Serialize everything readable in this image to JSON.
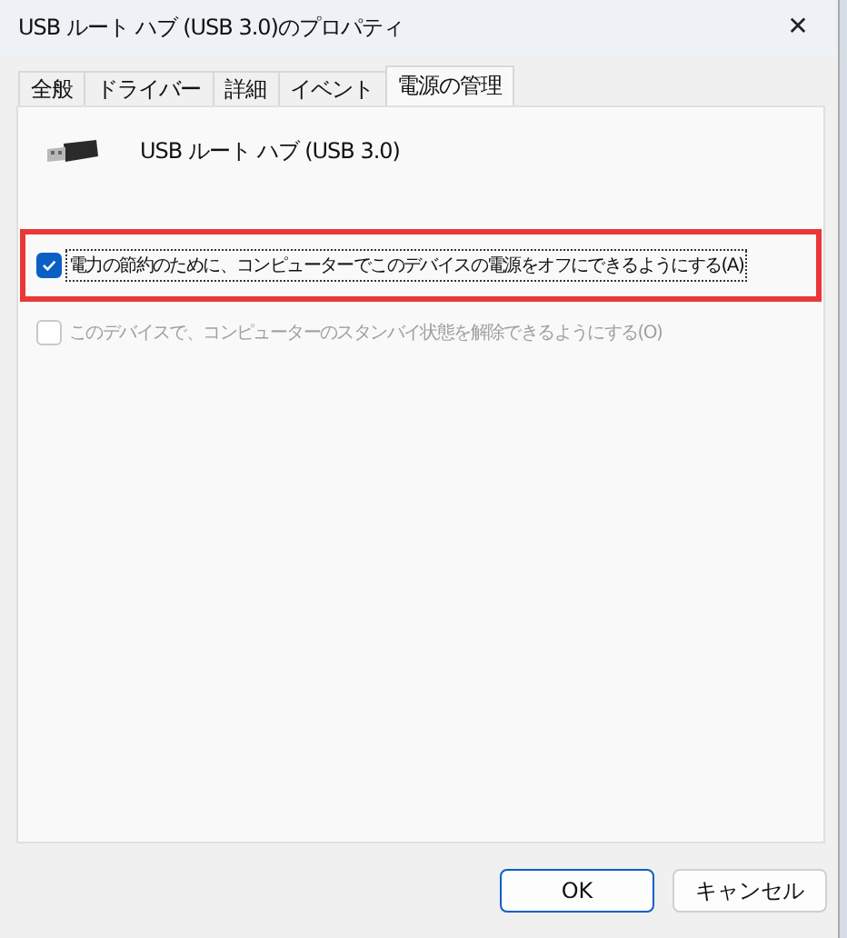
{
  "window": {
    "title": "USB ルート ハブ (USB 3.0)のプロパティ",
    "close": "✕"
  },
  "tabs": [
    {
      "label": "全般",
      "selected": false
    },
    {
      "label": "ドライバー",
      "selected": false
    },
    {
      "label": "詳細",
      "selected": false
    },
    {
      "label": "イベント",
      "selected": false
    },
    {
      "label": "電源の管理",
      "selected": true
    }
  ],
  "device": {
    "name": "USB ルート ハブ (USB 3.0)"
  },
  "options": [
    {
      "label": "電力の節約のために、コンピューターでこのデバイスの電源をオフにできるようにする(A)",
      "checked": true,
      "disabled": false,
      "highlighted": true,
      "focused": true
    },
    {
      "label": "このデバイスで、コンピューターのスタンバイ状態を解除できるようにする(O)",
      "checked": false,
      "disabled": true,
      "highlighted": false,
      "focused": false
    }
  ],
  "buttons": [
    {
      "label": "OK",
      "default": true
    },
    {
      "label": "キャンセル",
      "default": false
    }
  ]
}
